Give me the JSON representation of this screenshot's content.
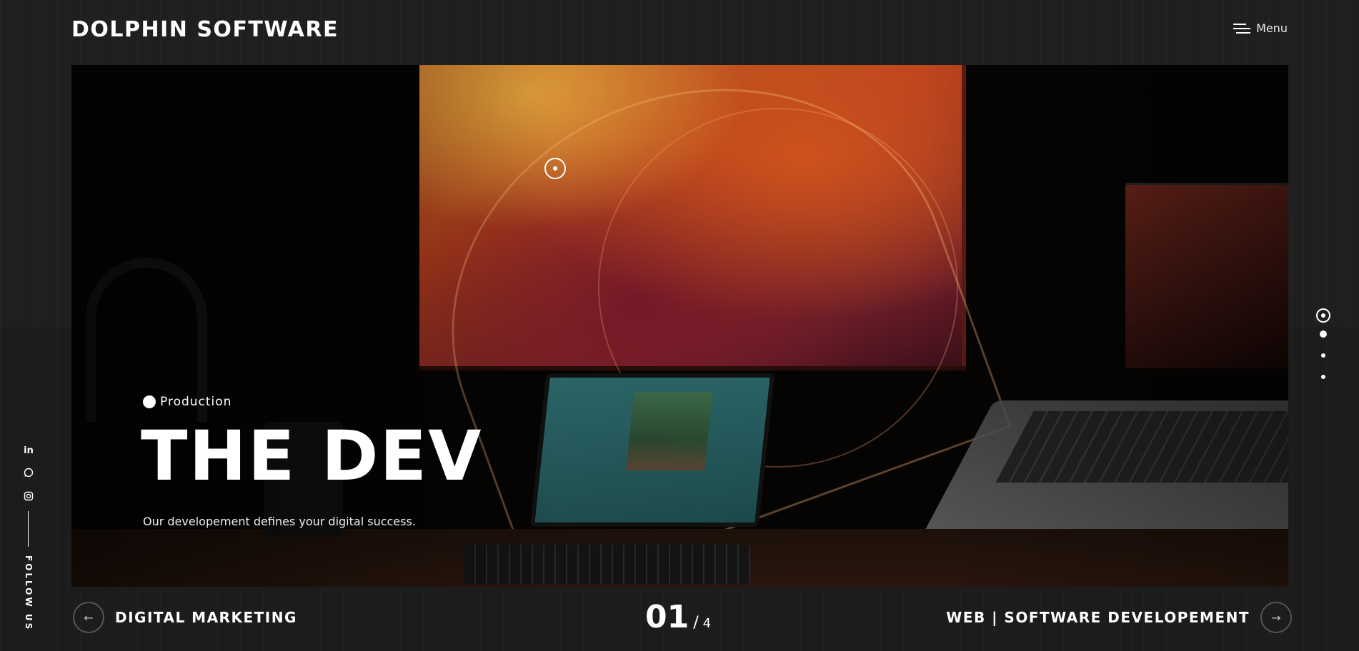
{
  "header": {
    "brand": "DOLPHIN SOFTWARE",
    "menu_label": "Menu"
  },
  "hero": {
    "category": "Production",
    "title": "THE DEV",
    "subtitle": "Our developement defines your digital success."
  },
  "slider": {
    "current": "01",
    "separator": "/",
    "total": "4",
    "prev_label": "DIGITAL MARKETING",
    "next_label": "WEB | SOFTWARE DEVELOPEMENT",
    "dots": [
      {
        "active": true
      },
      {
        "active": false
      },
      {
        "active": false
      },
      {
        "active": false
      }
    ]
  },
  "social": {
    "icons": [
      "linkedin-icon",
      "whatsapp-icon",
      "instagram-icon"
    ],
    "follow_label": "FOLLOW US"
  },
  "icons": {
    "prev_arrow": "←",
    "next_arrow": "→"
  },
  "colors": {
    "background": "#1c1c1c",
    "accent": "#ffffff"
  }
}
